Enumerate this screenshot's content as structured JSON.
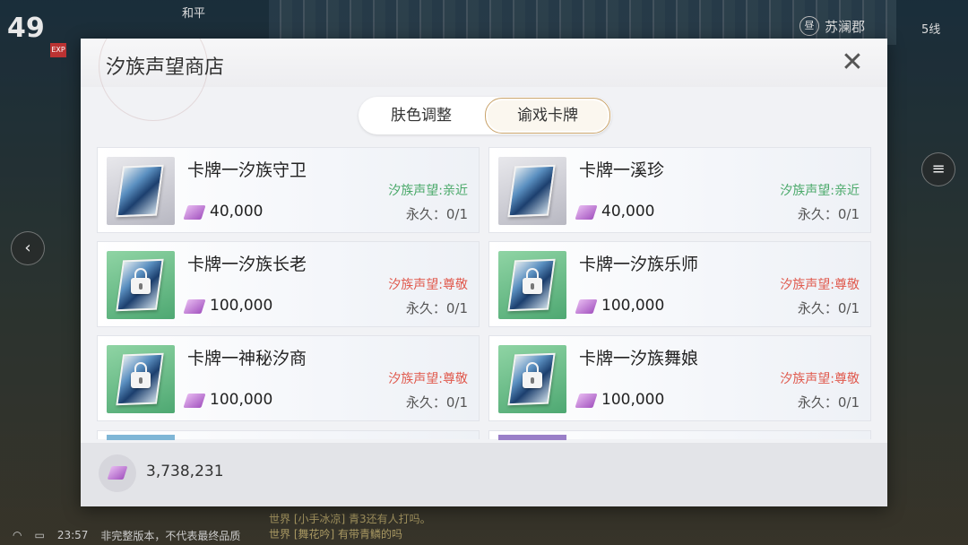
{
  "hud": {
    "level": "49",
    "exp_label": "EXP",
    "peace_mode": "和平",
    "day_icon_text": "昼",
    "map_name": "苏澜郡",
    "line": "5线",
    "time": "23:57",
    "version_notice": "非完整版本，不代表最终品质",
    "chat_1": "世界 [小手冰凉] 青3还有人打吗。",
    "chat_2": "世界 [舞花吟] 有带青鳞的吗"
  },
  "dialog": {
    "title": "汐族声望商店",
    "close_icon": "close-icon",
    "tabs": [
      {
        "label": "肤色调整",
        "active": false
      },
      {
        "label": "谕戏卡牌",
        "active": true
      }
    ]
  },
  "items": [
    {
      "name": "卡牌一汐族守卫",
      "price": "40,000",
      "requirement": "汐族声望:亲近",
      "requirement_color": "#4aa96a",
      "limit": "永久：0/1",
      "locked": false,
      "thumb": "gray"
    },
    {
      "name": "卡牌一溪珍",
      "price": "40,000",
      "requirement": "汐族声望:亲近",
      "requirement_color": "#4aa96a",
      "limit": "永久：0/1",
      "locked": false,
      "thumb": "gray"
    },
    {
      "name": "卡牌一汐族长老",
      "price": "100,000",
      "requirement": "汐族声望:尊敬",
      "requirement_color": "#e05a4e",
      "limit": "永久：0/1",
      "locked": true,
      "thumb": "green"
    },
    {
      "name": "卡牌一汐族乐师",
      "price": "100,000",
      "requirement": "汐族声望:尊敬",
      "requirement_color": "#e05a4e",
      "limit": "永久：0/1",
      "locked": true,
      "thumb": "green"
    },
    {
      "name": "卡牌一神秘汐商",
      "price": "100,000",
      "requirement": "汐族声望:尊敬",
      "requirement_color": "#e05a4e",
      "limit": "永久：0/1",
      "locked": true,
      "thumb": "green"
    },
    {
      "name": "卡牌一汐族舞娘",
      "price": "100,000",
      "requirement": "汐族声望:尊敬",
      "requirement_color": "#e05a4e",
      "limit": "永久：0/1",
      "locked": true,
      "thumb": "green"
    }
  ],
  "footer": {
    "currency_icon": "reputation-token-icon",
    "currency_amount": "3,738,231"
  }
}
